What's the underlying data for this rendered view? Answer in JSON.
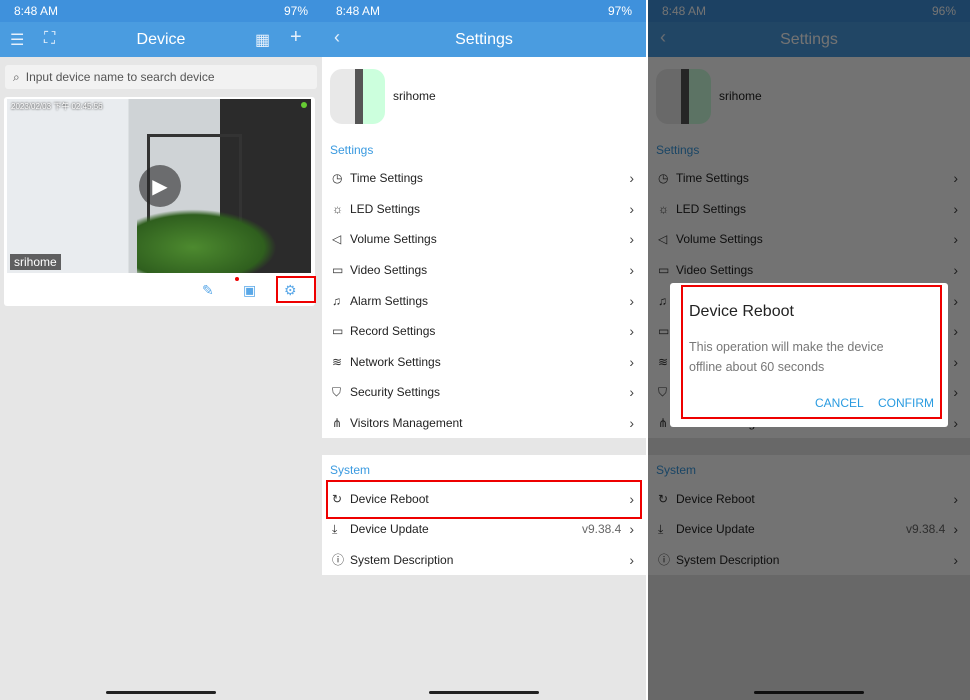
{
  "status": {
    "time1": "8:48 AM",
    "time2": "8:48 AM",
    "time3": "8:48 AM",
    "battery1": "97%",
    "battery2": "97%",
    "battery3": "96%"
  },
  "device_page": {
    "title": "Device",
    "search_placeholder": "Input device name to search device",
    "camera": {
      "name": "srihome",
      "timestamp": "2023/02/03 下午 02:45:56",
      "online_color": "#66cc33"
    }
  },
  "settings_page": {
    "title": "Settings",
    "device_name": "srihome",
    "settings_label": "Settings",
    "settings_items": [
      {
        "label": "Time Settings",
        "icon": "clock-icon"
      },
      {
        "label": "LED Settings",
        "icon": "bulb-icon"
      },
      {
        "label": "Volume Settings",
        "icon": "speaker-icon"
      },
      {
        "label": "Video Settings",
        "icon": "video-icon"
      },
      {
        "label": "Alarm Settings",
        "icon": "bell-icon"
      },
      {
        "label": "Record Settings",
        "icon": "camcorder-icon"
      },
      {
        "label": "Network Settings",
        "icon": "wifi-icon"
      },
      {
        "label": "Security Settings",
        "icon": "shield-icon"
      },
      {
        "label": "Visitors Management",
        "icon": "share-icon"
      }
    ],
    "system_label": "System",
    "system_items": [
      {
        "label": "Device Reboot",
        "icon": "reboot-icon",
        "value": ""
      },
      {
        "label": "Device Update",
        "icon": "download-icon",
        "value": "v9.38.4"
      },
      {
        "label": "System Description",
        "icon": "info-icon",
        "value": ""
      }
    ]
  },
  "dialog": {
    "title": "Device Reboot",
    "message": "This operation will make the device offline about 60 seconds",
    "cancel": "CANCEL",
    "confirm": "CONFIRM"
  },
  "colors": {
    "accent": "#4a9ce0",
    "highlight": "#ee0000",
    "link": "#2a9be0"
  }
}
